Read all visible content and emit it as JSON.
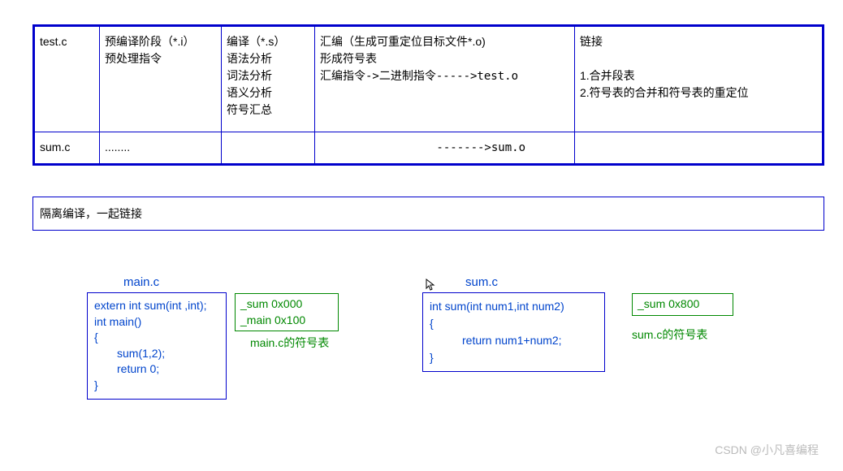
{
  "table": {
    "row1": {
      "c1a": "test.c",
      "c2a": "预编译阶段（*.i）",
      "c2b": "预处理指令",
      "c3a": "编译（*.s）",
      "c3b": "语法分析",
      "c3c": "词法分析",
      "c3d": "语义分析",
      "c3e": "符号汇总",
      "c4a": "汇编（生成可重定位目标文件*.o)",
      "c4b": "形成符号表",
      "c4c": " 汇编指令->二进制指令----->test.o",
      "c5a": "链接",
      "c5b": "1.合并段表",
      "c5c": "2.符号表的合并和符号表的重定位"
    },
    "row2": {
      "c1": "sum.c",
      "c2": "........",
      "c4": "------->sum.o"
    }
  },
  "separator": "隔离编译，一起链接",
  "mainLabel": "main.c",
  "sumLabel": "sum.c",
  "mainCode": {
    "l1": "extern int sum(int ,int);",
    "l2": "int main()",
    "l3": "{",
    "l4": "sum(1,2);",
    "l5": "return 0;",
    "l6": "}"
  },
  "sumCode": {
    "l1": "int sum(int num1,int num2)",
    "l2": "{",
    "l3": "return num1+num2;",
    "l4": "}"
  },
  "mainSym": {
    "l1": "_sum    0x000",
    "l2": "_main  0x100"
  },
  "sumSym": {
    "l1": "_sum   0x800"
  },
  "mainSymCaption": "main.c的符号表",
  "sumSymCaption": "sum.c的符号表",
  "watermark": "CSDN @小凡喜编程"
}
